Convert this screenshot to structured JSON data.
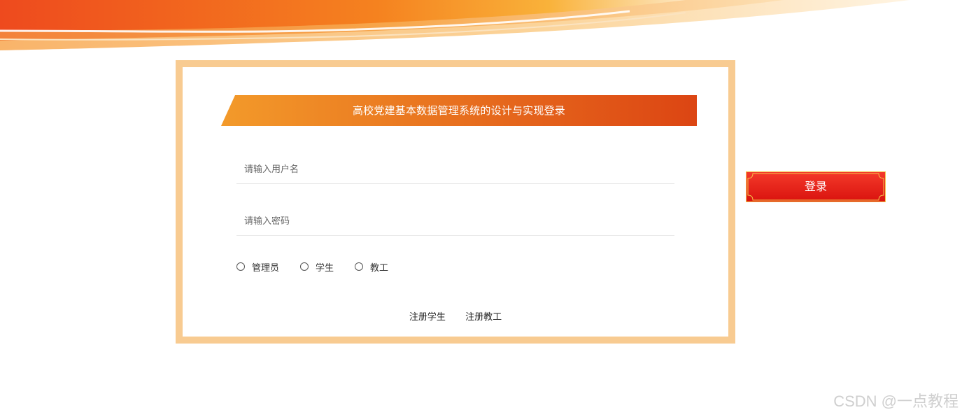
{
  "colors": {
    "frame_border": "#f8cb91",
    "title_gradient_start": "#f39a2a",
    "title_gradient_end": "#dc4513",
    "login_button_red": "#e8221a",
    "login_button_gold": "#f5c54a",
    "banner_orange": "#f06a1f",
    "banner_yellow": "#f7b52b"
  },
  "header": {
    "title": "高校党建基本数据管理系统的设计与实现登录"
  },
  "form": {
    "username_placeholder": "请输入用户名",
    "username_value": "",
    "password_placeholder": "请输入密码",
    "password_value": "",
    "roles": [
      {
        "label": "管理员",
        "selected": false
      },
      {
        "label": "学生",
        "selected": false
      },
      {
        "label": "教工",
        "selected": false
      }
    ]
  },
  "links": {
    "register_student": "注册学生",
    "register_staff": "注册教工"
  },
  "actions": {
    "login_label": "登录"
  },
  "watermark": {
    "text": "CSDN @一点教程"
  }
}
